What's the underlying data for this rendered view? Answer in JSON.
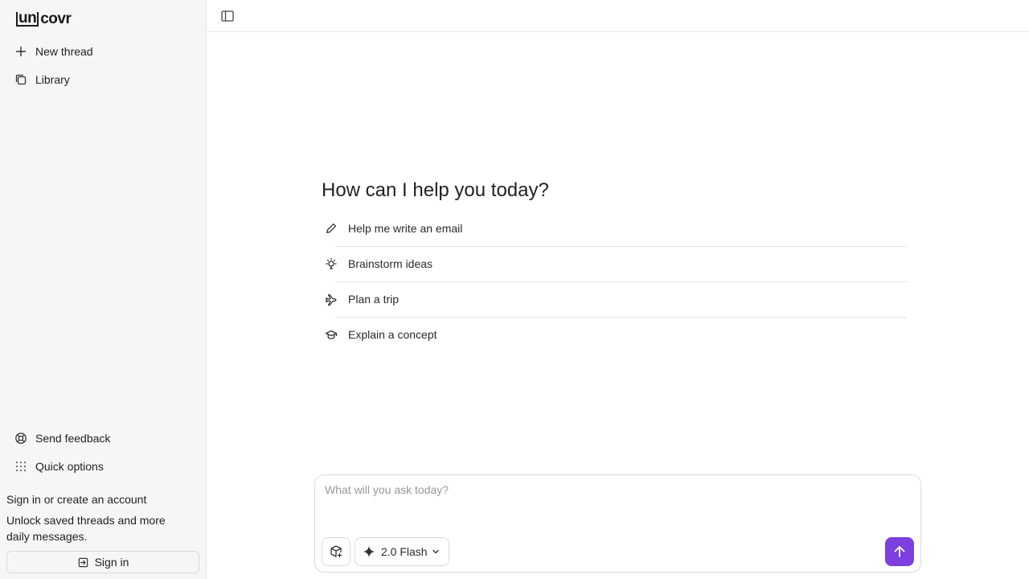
{
  "brand": {
    "logo_bracket": "un",
    "logo_rest": "covr"
  },
  "sidebar": {
    "items": [
      {
        "label": "New thread",
        "icon": "plus-icon"
      },
      {
        "label": "Library",
        "icon": "library-icon"
      }
    ],
    "footer_items": [
      {
        "label": "Send feedback",
        "icon": "lifebuoy-icon"
      },
      {
        "label": "Quick options",
        "icon": "grid-dots-icon"
      }
    ],
    "signin": {
      "title": "Sign in or create an account",
      "description": "Unlock saved threads and more daily messages.",
      "button_label": "Sign in"
    }
  },
  "main": {
    "heading": "How can I help you today?",
    "suggestions": [
      {
        "label": "Help me write an email",
        "icon": "pencil-icon"
      },
      {
        "label": "Brainstorm ideas",
        "icon": "lightbulb-icon"
      },
      {
        "label": "Plan a trip",
        "icon": "plane-icon"
      },
      {
        "label": "Explain a concept",
        "icon": "graduation-cap-icon"
      }
    ]
  },
  "composer": {
    "placeholder": "What will you ask today?",
    "model_label": "2.0 Flash"
  },
  "colors": {
    "accent": "#7d3fe0",
    "sidebar_bg": "#f7f6f4"
  }
}
